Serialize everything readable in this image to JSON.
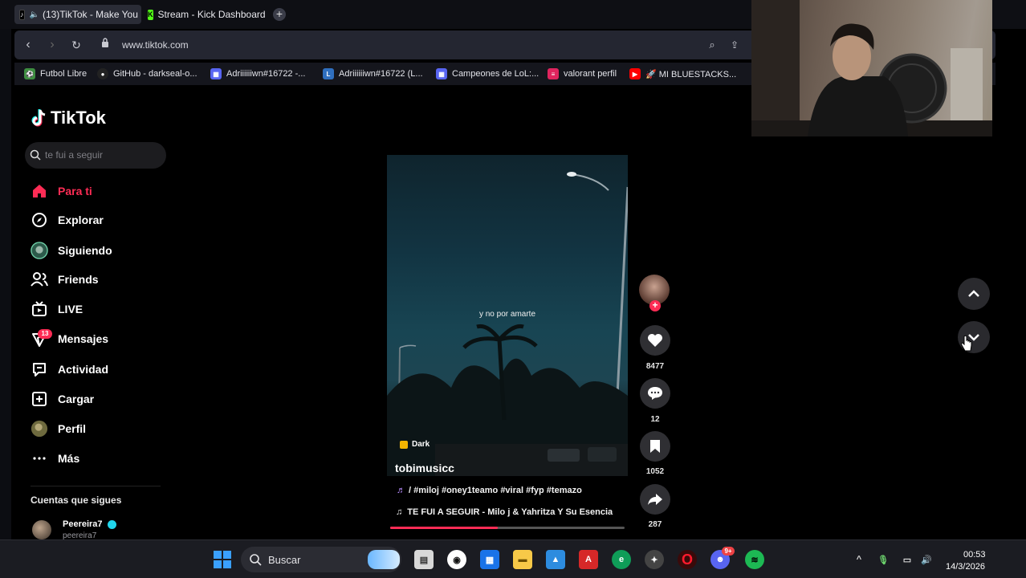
{
  "browser": {
    "tabs": [
      {
        "label": "(13)TikTok - Make You",
        "active": true
      },
      {
        "label": "Stream - Kick Dashboard",
        "active": false
      }
    ],
    "url": "www.tiktok.com",
    "bookmarks": [
      {
        "label": "Futbol Libre",
        "color": "#3e8e41"
      },
      {
        "label": "GitHub - darkseal-o...",
        "color": "#333"
      },
      {
        "label": "Adriiiiiiwn#16722 -...",
        "color": "#5865f2"
      },
      {
        "label": "Adriiiiiiwn#16722 (L...",
        "color": "#2f6fbf"
      },
      {
        "label": "Campeones de LoL:...",
        "color": "#5865f2"
      },
      {
        "label": "valorant perfil",
        "color": "#e0245e"
      },
      {
        "label": "🚀 MI BLUESTACKS...",
        "color": "#ff0000"
      }
    ]
  },
  "tiktok": {
    "logo_text": "TikTok",
    "search_placeholder": "te fui a seguir",
    "nav": [
      {
        "label": "Para ti",
        "icon": "home-icon",
        "active": true
      },
      {
        "label": "Explorar",
        "icon": "compass-icon"
      },
      {
        "label": "Siguiendo",
        "icon": "following-avatar-icon"
      },
      {
        "label": "Friends",
        "icon": "friends-icon"
      },
      {
        "label": "LIVE",
        "icon": "live-icon"
      },
      {
        "label": "Mensajes",
        "icon": "messages-icon",
        "badge": "13"
      },
      {
        "label": "Actividad",
        "icon": "activity-icon"
      },
      {
        "label": "Cargar",
        "icon": "upload-icon"
      },
      {
        "label": "Perfil",
        "icon": "profile-avatar-icon"
      },
      {
        "label": "Más",
        "icon": "more-icon"
      }
    ],
    "following_title": "Cuentas que sigues",
    "following": [
      {
        "name": "Peereira7",
        "handle": "peereira7"
      }
    ],
    "video": {
      "caption": "y no por amarte",
      "tag": "Dark",
      "author": "tobimusicc",
      "description": "/ #miloj #oney1teamo #viral #fyp #temazo",
      "music": "TE FUI A SEGUIR - Milo j & Yahritza Y Su Esencia",
      "progress": 0.46,
      "likes": "8477",
      "comments": "12",
      "saves": "1052",
      "shares": "287"
    }
  },
  "taskbar": {
    "search_label": "Buscar",
    "time": "00:53",
    "date": "14/3/2026",
    "discord_badge": "9+"
  },
  "colors": {
    "accent": "#fe2c55",
    "background": "#000000",
    "taskbar": "#1b1c22"
  }
}
